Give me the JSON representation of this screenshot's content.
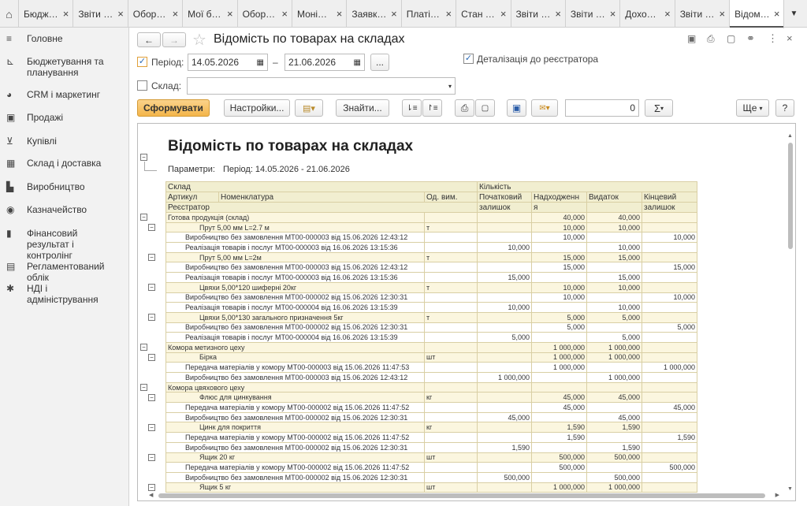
{
  "tabs": [
    "Бюдж…",
    "Звіти …",
    "Обор…",
    "Мої б…",
    "Обор…",
    "Моні…",
    "Заявк…",
    "Платі…",
    "Стан …",
    "Звіти …",
    "Звіти …",
    "Дохо…",
    "Звіти …",
    "Відом…"
  ],
  "sidebar": [
    {
      "label": "Головне",
      "icon": "≡"
    },
    {
      "label": "Бюджетування та планування",
      "icon": "⊾"
    },
    {
      "label": "CRM і маркетинг",
      "icon": "◕"
    },
    {
      "label": "Продажі",
      "icon": "▣"
    },
    {
      "label": "Купівлі",
      "icon": "⊻"
    },
    {
      "label": "Склад і доставка",
      "icon": "▦"
    },
    {
      "label": "Виробництво",
      "icon": "▙"
    },
    {
      "label": "Казначейство",
      "icon": "◉"
    },
    {
      "label": "Фінансовий результат і контролінг",
      "icon": "▮"
    },
    {
      "label": "Регламентований облік",
      "icon": "▤"
    },
    {
      "label": "НДІ і адміністрування",
      "icon": "✱"
    }
  ],
  "form": {
    "title": "Відомість по товарах на складах",
    "period_label": "Період:",
    "date_from": "14.05.2026",
    "dash": "–",
    "date_to": "21.06.2026",
    "dots": "...",
    "detail_label": "Деталізація до реєстратора",
    "warehouse_label": "Склад:",
    "warehouse_value": ""
  },
  "toolbar": {
    "form_btn": "Сформувати",
    "settings_btn": "Настройки...",
    "find_btn": "Знайти...",
    "sum_value": "0",
    "sigma": "Σ",
    "more_btn": "Ще",
    "help_btn": "?"
  },
  "report": {
    "title": "Відомість по товарах на складах",
    "params_label": "Параметри:",
    "params_value": "Період: 14.05.2026 - 21.06.2026"
  },
  "header": {
    "warehouse": "Склад",
    "qty": "Кількість",
    "article": "Артикул",
    "nomen": "Номенклатура",
    "unit": "Од. вим.",
    "start": "Початковий",
    "income": "Надходженн",
    "expense": "Видаток",
    "end": "Кінцевий",
    "registrar": "Реєстратор",
    "start2": "залишок",
    "income2": "я",
    "end2": "залишок"
  },
  "rows": [
    {
      "l": 0,
      "t": "Готова продукція (склад)",
      "u": "",
      "s": "",
      "i": "40,000",
      "e": "40,000",
      "f": "",
      "k": "g"
    },
    {
      "l": 1,
      "t": "Прут 5,00 мм L=2.7 м",
      "u": "т",
      "s": "",
      "i": "10,000",
      "e": "10,000",
      "f": "",
      "k": "n"
    },
    {
      "l": 2,
      "t": "Виробництво без замовлення МТ00-000003 від 15.06.2026 12:43:12",
      "u": "",
      "s": "",
      "i": "10,000",
      "e": "",
      "f": "10,000",
      "k": "r"
    },
    {
      "l": 2,
      "t": "Реалізація товарів і послуг МТ00-000003 від 16.06.2026 13:15:36",
      "u": "",
      "s": "10,000",
      "i": "",
      "e": "10,000",
      "f": "",
      "k": "r"
    },
    {
      "l": 1,
      "t": "Прут 5,00 мм L=2м",
      "u": "т",
      "s": "",
      "i": "15,000",
      "e": "15,000",
      "f": "",
      "k": "n"
    },
    {
      "l": 2,
      "t": "Виробництво без замовлення МТ00-000003 від 15.06.2026 12:43:12",
      "u": "",
      "s": "",
      "i": "15,000",
      "e": "",
      "f": "15,000",
      "k": "r"
    },
    {
      "l": 2,
      "t": "Реалізація товарів і послуг МТ00-000003 від 16.06.2026 13:15:36",
      "u": "",
      "s": "15,000",
      "i": "",
      "e": "15,000",
      "f": "",
      "k": "r"
    },
    {
      "l": 1,
      "t": "Цвяхи 5,00*120 шиферні 20кг",
      "u": "т",
      "s": "",
      "i": "10,000",
      "e": "10,000",
      "f": "",
      "k": "n"
    },
    {
      "l": 2,
      "t": "Виробництво без замовлення МТ00-000002 від 15.06.2026 12:30:31",
      "u": "",
      "s": "",
      "i": "10,000",
      "e": "",
      "f": "10,000",
      "k": "r"
    },
    {
      "l": 2,
      "t": "Реалізація товарів і послуг МТ00-000004 від 16.06.2026 13:15:39",
      "u": "",
      "s": "10,000",
      "i": "",
      "e": "10,000",
      "f": "",
      "k": "r"
    },
    {
      "l": 1,
      "t": "Цвяхи 5,00*130 загального призначення 5кг",
      "u": "т",
      "s": "",
      "i": "5,000",
      "e": "5,000",
      "f": "",
      "k": "n"
    },
    {
      "l": 2,
      "t": "Виробництво без замовлення МТ00-000002 від 15.06.2026 12:30:31",
      "u": "",
      "s": "",
      "i": "5,000",
      "e": "",
      "f": "5,000",
      "k": "r"
    },
    {
      "l": 2,
      "t": "Реалізація товарів і послуг МТ00-000004 від 16.06.2026 13:15:39",
      "u": "",
      "s": "5,000",
      "i": "",
      "e": "5,000",
      "f": "",
      "k": "r"
    },
    {
      "l": 0,
      "t": "Комора метизного цеху",
      "u": "",
      "s": "",
      "i": "1 000,000",
      "e": "1 000,000",
      "f": "",
      "k": "g"
    },
    {
      "l": 1,
      "t": "Бірка",
      "u": "шт",
      "s": "",
      "i": "1 000,000",
      "e": "1 000,000",
      "f": "",
      "k": "n"
    },
    {
      "l": 2,
      "t": "Передача матеріалів у комору МТ00-000003 від 15.06.2026 11:47:53",
      "u": "",
      "s": "",
      "i": "1 000,000",
      "e": "",
      "f": "1 000,000",
      "k": "r"
    },
    {
      "l": 2,
      "t": "Виробництво без замовлення МТ00-000003 від 15.06.2026 12:43:12",
      "u": "",
      "s": "1 000,000",
      "i": "",
      "e": "1 000,000",
      "f": "",
      "k": "r"
    },
    {
      "l": 0,
      "t": "Комора цвяхового цеху",
      "u": "",
      "s": "",
      "i": "",
      "e": "",
      "f": "",
      "k": "g"
    },
    {
      "l": 1,
      "t": "Флюс для цинкування",
      "u": "кг",
      "s": "",
      "i": "45,000",
      "e": "45,000",
      "f": "",
      "k": "n"
    },
    {
      "l": 2,
      "t": "Передача матеріалів у комору МТ00-000002 від 15.06.2026 11:47:52",
      "u": "",
      "s": "",
      "i": "45,000",
      "e": "",
      "f": "45,000",
      "k": "r"
    },
    {
      "l": 2,
      "t": "Виробництво без замовлення МТ00-000002 від 15.06.2026 12:30:31",
      "u": "",
      "s": "45,000",
      "i": "",
      "e": "45,000",
      "f": "",
      "k": "r"
    },
    {
      "l": 1,
      "t": "Цинк для покриття",
      "u": "кг",
      "s": "",
      "i": "1,590",
      "e": "1,590",
      "f": "",
      "k": "n"
    },
    {
      "l": 2,
      "t": "Передача матеріалів у комору МТ00-000002 від 15.06.2026 11:47:52",
      "u": "",
      "s": "",
      "i": "1,590",
      "e": "",
      "f": "1,590",
      "k": "r"
    },
    {
      "l": 2,
      "t": "Виробництво без замовлення МТ00-000002 від 15.06.2026 12:30:31",
      "u": "",
      "s": "1,590",
      "i": "",
      "e": "1,590",
      "f": "",
      "k": "r"
    },
    {
      "l": 1,
      "t": "Ящик 20 кг",
      "u": "шт",
      "s": "",
      "i": "500,000",
      "e": "500,000",
      "f": "",
      "k": "n"
    },
    {
      "l": 2,
      "t": "Передача матеріалів у комору МТ00-000002 від 15.06.2026 11:47:52",
      "u": "",
      "s": "",
      "i": "500,000",
      "e": "",
      "f": "500,000",
      "k": "r"
    },
    {
      "l": 2,
      "t": "Виробництво без замовлення МТ00-000002 від 15.06.2026 12:30:31",
      "u": "",
      "s": "500,000",
      "i": "",
      "e": "500,000",
      "f": "",
      "k": "r"
    },
    {
      "l": 1,
      "t": "Ящик 5 кг",
      "u": "шт",
      "s": "",
      "i": "1 000,000",
      "e": "1 000,000",
      "f": "",
      "k": "n"
    }
  ]
}
